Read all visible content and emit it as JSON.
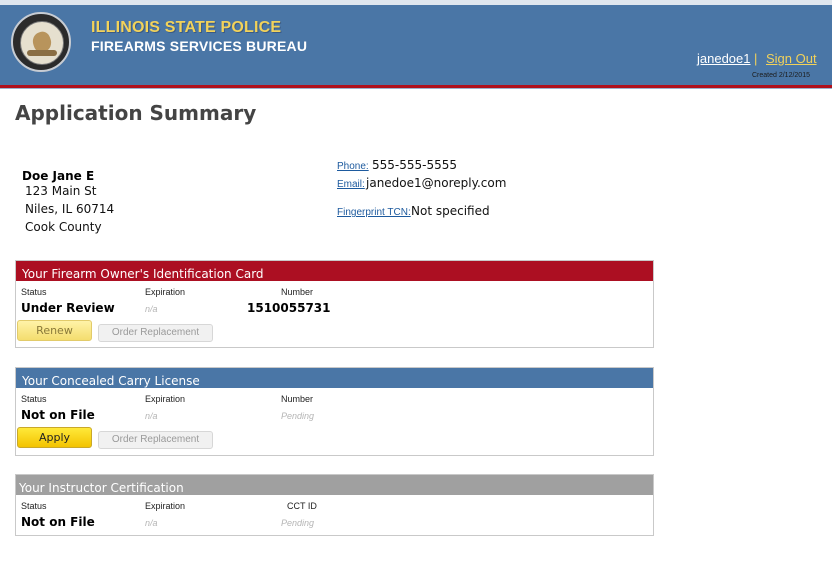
{
  "header": {
    "title_line1": "ILLINOIS STATE POLICE",
    "title_line2": "FIREARMS SERVICES BUREAU",
    "username": "janedoe1",
    "separator": "|",
    "sign_out": "Sign Out",
    "created": "Created 2/12/2015",
    "colors": {
      "header_bg": "#4a76a6",
      "accent_yellow": "#f2d25a",
      "accent_red": "#b0101c"
    }
  },
  "page": {
    "title": "Application Summary"
  },
  "applicant": {
    "name": "Doe Jane E",
    "address_line1": "123 Main St",
    "address_line2": "Niles, IL 60714",
    "county": "Cook County"
  },
  "contact": {
    "phone_label": "Phone:",
    "phone": "555-555-5555",
    "email_label": "Email:",
    "email": "janedoe1@noreply.com",
    "tcn_label": "Fingerprint TCN:",
    "tcn": "Not specified"
  },
  "foid": {
    "heading": "Your Firearm Owner's Identification Card",
    "status_label": "Status",
    "expiration_label": "Expiration",
    "number_label": "Number",
    "status": "Under Review",
    "expiration": "n/a",
    "number": "1510055731",
    "primary_button": "Renew",
    "secondary_button": "Order Replacement"
  },
  "ccl": {
    "heading": "Your Concealed Carry License",
    "status_label": "Status",
    "expiration_label": "Expiration",
    "number_label": "Number",
    "status": "Not on File",
    "expiration": "n/a",
    "number": "Pending",
    "primary_button": "Apply",
    "secondary_button": "Order Replacement"
  },
  "instructor": {
    "heading": "Your Instructor Certification",
    "status_label": "Status",
    "expiration_label": "Expiration",
    "id_label": "CCT ID",
    "status": "Not on File",
    "expiration": "n/a",
    "id": "Pending"
  }
}
